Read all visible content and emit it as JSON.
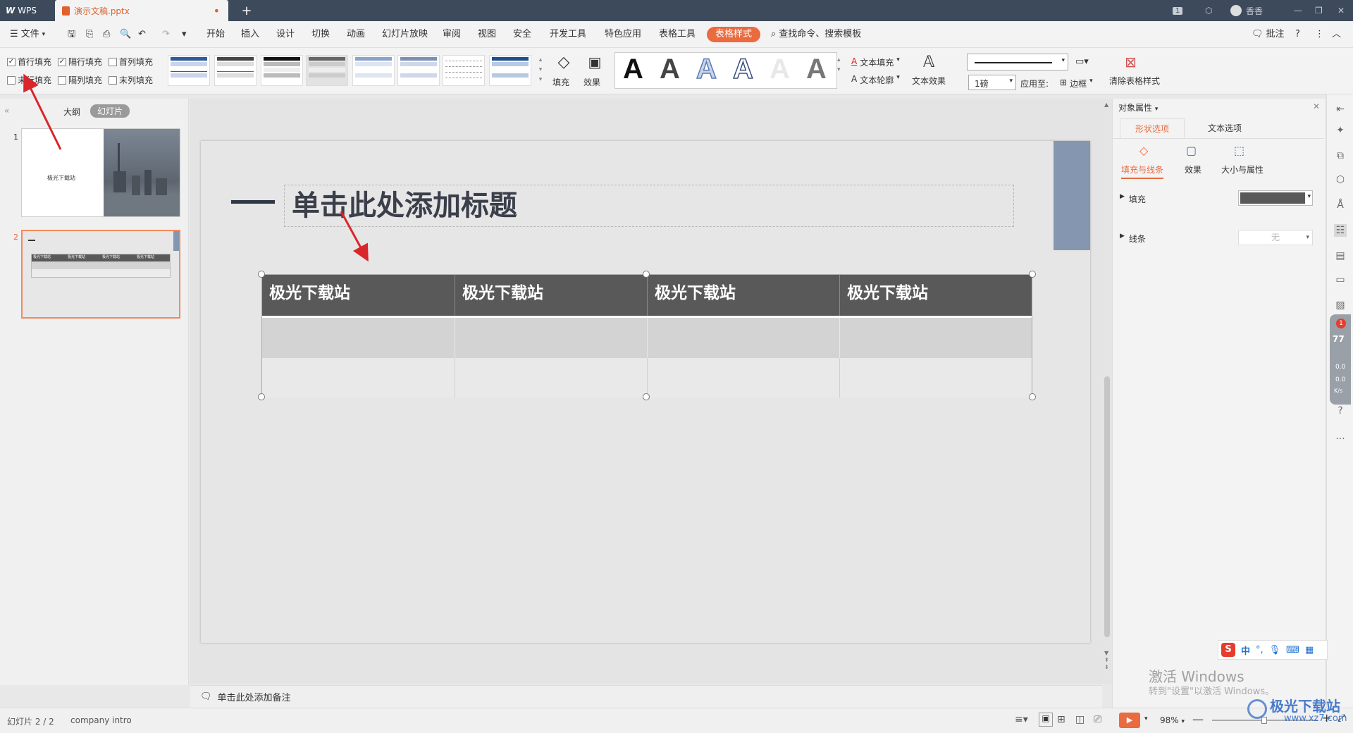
{
  "titlebar": {
    "app_tab": "WPS",
    "doc_tab": "演示文稿.pptx",
    "new_tab": "+",
    "page_badge": "1",
    "user": "香香"
  },
  "menu": {
    "file": "文件",
    "items": [
      "开始",
      "插入",
      "设计",
      "切换",
      "动画",
      "幻灯片放映",
      "审阅",
      "视图",
      "安全",
      "开发工具",
      "特色应用",
      "表格工具",
      "表格样式"
    ],
    "search": "查找命令、搜索模板",
    "comment": "批注"
  },
  "ribbon": {
    "checkboxes": [
      {
        "label": "首行填充",
        "checked": true
      },
      {
        "label": "隔行填充",
        "checked": true
      },
      {
        "label": "首列填充",
        "checked": false
      },
      {
        "label": "末行填充",
        "checked": false
      },
      {
        "label": "隔列填充",
        "checked": false
      },
      {
        "label": "末列填充",
        "checked": false
      }
    ],
    "fill": "填充",
    "effect": "效果",
    "text_fill": "文本填充",
    "text_outline": "文本轮廓",
    "text_effect": "文本效果",
    "line_weight": "1磅",
    "apply_to": "应用至:",
    "border": "边框",
    "clear_style": "清除表格样式"
  },
  "left_panel": {
    "tab_outline": "大纲",
    "tab_slides": "幻灯片",
    "slide1_number": "1",
    "slide1_text": "极光下载站",
    "slide2_number": "2",
    "slide2_header": "极光下载站"
  },
  "slide": {
    "title_placeholder": "单击此处添加标题",
    "table_headers": [
      "极光下载站",
      "极光下载站",
      "极光下载站",
      "极光下载站"
    ]
  },
  "notes": {
    "placeholder": "单击此处添加备注"
  },
  "status": {
    "slide_counter": "幻灯片 2 / 2",
    "theme": "company intro",
    "zoom": "98%"
  },
  "right_panel": {
    "title": "对象属性",
    "tab_shape": "形状选项",
    "tab_text": "文本选项",
    "sub_fill_line": "填充与线条",
    "sub_effect": "效果",
    "sub_size": "大小与属性",
    "fill_label": "填充",
    "line_label": "线条",
    "line_value": "无"
  },
  "side_widget": {
    "badge": "1",
    "percent": "77",
    "up": "0.0",
    "down": "0.0",
    "unit": "K/s"
  },
  "ime": {
    "lang": "中"
  },
  "watermark": {
    "activate": "激活 Windows",
    "activate_sub": "转到\"设置\"以激活 Windows。",
    "logo": "极光下载站",
    "site": "www.xz7.com"
  },
  "colors": {
    "accent": "#e96b3f",
    "header_fill": "#595959",
    "deco_bar": "#8496b0",
    "arrow": "#d9262b"
  }
}
